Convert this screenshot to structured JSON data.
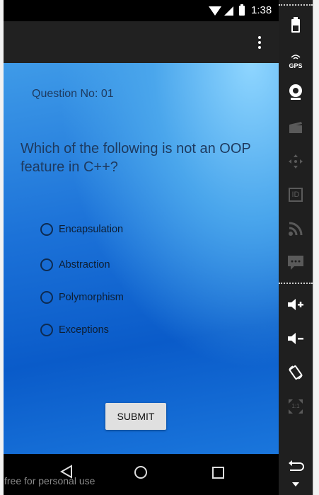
{
  "status_bar": {
    "time": "1:38"
  },
  "quiz": {
    "question_number": "Question No: 01",
    "question_text": "Which of the following is not an OOP feature in C++?",
    "options": [
      "Encapsulation",
      "Abstraction",
      "Polymorphism",
      "Exceptions"
    ],
    "submit_label": "SUBMIT"
  },
  "watermark": "free for personal use",
  "side_panel": {
    "gps_label": "GPS",
    "id_label": "ID",
    "scale_label": "1:1"
  },
  "colors": {
    "app_bar": "#212121",
    "content_top": "#8fd6ff",
    "content_bottom": "#0a5bc9",
    "text_dark": "#1e3a5f"
  }
}
